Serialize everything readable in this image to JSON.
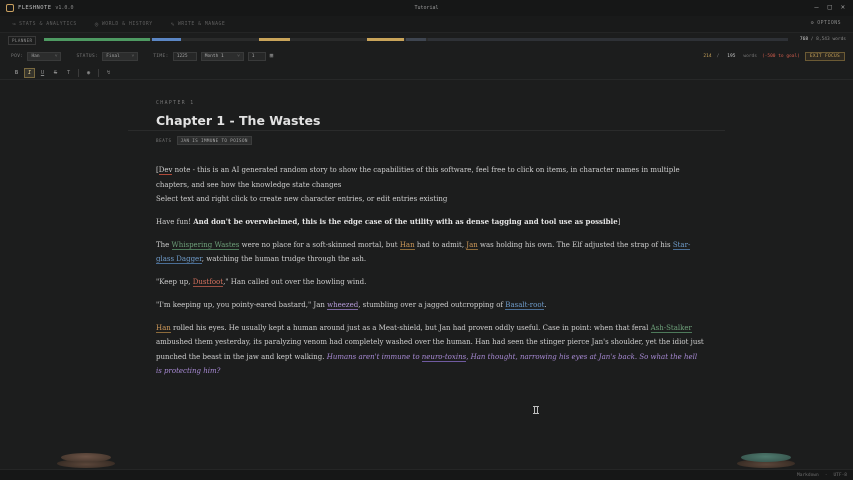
{
  "app": {
    "name": "FLESHNOTE",
    "version": "v1.0.0",
    "window_title": "Tutorial"
  },
  "tabs": [
    {
      "label": "STATS & ANALYTICS",
      "icon": "chart-icon"
    },
    {
      "label": "WORLD & HISTORY",
      "icon": "globe-icon"
    },
    {
      "label": "WRITE & MANAGE",
      "icon": "pen-icon"
    }
  ],
  "options_label": "OPTIONS",
  "progress": {
    "planner_label": "PLANNER",
    "current": "768",
    "total": "/ 8,543 words",
    "fraction": 0.0899
  },
  "toolbar": {
    "pov_label": "POV:",
    "pov_value": "Han",
    "status_label": "STATUS:",
    "status_value": "Final",
    "time_label": "TIME:",
    "year_value": "1225",
    "month_value": "Month 1",
    "day_value": "1",
    "word_count": "214",
    "word_sep": "/",
    "word_target": "195",
    "words_label": "words",
    "goal_text": "(-500 to goal)",
    "exit_focus": "EXIT FOCUS"
  },
  "format_buttons": [
    "B",
    "I",
    "U",
    "S",
    "T"
  ],
  "chapter": {
    "label": "CHAPTER 1",
    "title": "Chapter 1 - The Wastes",
    "beats_label": "BEATS",
    "beat_tag": "JAN IS IMMUNE TO POISON"
  },
  "prose": {
    "p1a": "[",
    "p1b": "Dev",
    "p1c": " note - this is an AI generated random story to show the capabilities of this software, feel free to click on items, in character names in multiple chapters, and see how the knowledge state changes",
    "p2": "Select text and right click to create new character entries, or edit entries existing",
    "p3a": "Have fun! ",
    "p3b": "And don't be overwhelmed, this is the edge case of the utility with as dense tagging and tool use as possible",
    "p3c": "]",
    "p4a": "The ",
    "p4_place": "Whispering Wastes",
    "p4b": " were no place for a soft-skinned mortal, but ",
    "p4_han": "Han",
    "p4c": " had to admit, ",
    "p4_jan": "Jan",
    "p4d": " was holding his own. The Elf adjusted the strap of his ",
    "p4_item": "Star-glass Dagger",
    "p4e": ", watching the human trudge through the ash.",
    "p5a": "\"Keep up, ",
    "p5_creature": "Dustfoot",
    "p5b": ",\" Han called out over the howling wind.",
    "p6a": "\"I'm keeping up, you pointy-eared bastard,\" Jan ",
    "p6_verb": "wheezed",
    "p6b": ", stumbling over a jagged outcropping of ",
    "p6_item": "Basalt-root",
    "p6c": ".",
    "p7_han": "Han",
    "p7a": " rolled his eyes. He usually kept a human around just as a Meat-shield, but Jan had proven oddly useful. Case in point: when that feral ",
    "p7_creature": "Ash-Stalker",
    "p7b": " ambushed them yesterday, its paralyzing venom had completely washed over the human. Han had seen the stinger pierce Jan's shoulder, yet the idiot just punched the beast in the jaw and kept walking. ",
    "p7_it1": "Humans aren't immune to ",
    "p7_it1u": "neuro-toxins",
    "p7_it2": ", Han thought, narrowing his eyes at Jan's back.",
    "p7_it3": " So what the hell is protecting him?"
  },
  "status": {
    "mode": "Markdown",
    "encoding": "UTF-8"
  },
  "colors": {
    "accent": "#c9a45a",
    "place": "#6ea07a",
    "character": "#cf9a5a",
    "item": "#6f9ccb",
    "creature": "#d7735f"
  }
}
